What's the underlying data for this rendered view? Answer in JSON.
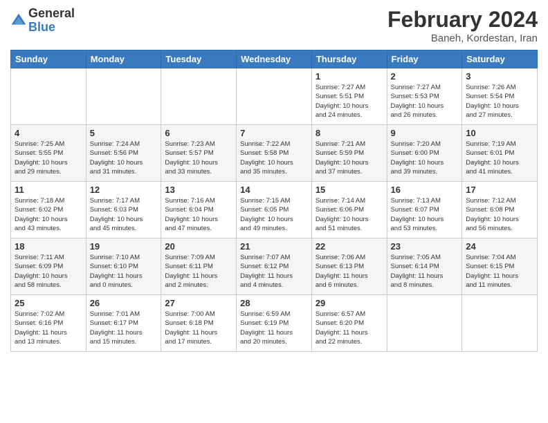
{
  "header": {
    "logo_line1": "General",
    "logo_line2": "Blue",
    "month_year": "February 2024",
    "location": "Baneh, Kordestan, Iran"
  },
  "weekdays": [
    "Sunday",
    "Monday",
    "Tuesday",
    "Wednesday",
    "Thursday",
    "Friday",
    "Saturday"
  ],
  "weeks": [
    [
      {
        "day": "",
        "info": ""
      },
      {
        "day": "",
        "info": ""
      },
      {
        "day": "",
        "info": ""
      },
      {
        "day": "",
        "info": ""
      },
      {
        "day": "1",
        "info": "Sunrise: 7:27 AM\nSunset: 5:51 PM\nDaylight: 10 hours\nand 24 minutes."
      },
      {
        "day": "2",
        "info": "Sunrise: 7:27 AM\nSunset: 5:53 PM\nDaylight: 10 hours\nand 26 minutes."
      },
      {
        "day": "3",
        "info": "Sunrise: 7:26 AM\nSunset: 5:54 PM\nDaylight: 10 hours\nand 27 minutes."
      }
    ],
    [
      {
        "day": "4",
        "info": "Sunrise: 7:25 AM\nSunset: 5:55 PM\nDaylight: 10 hours\nand 29 minutes."
      },
      {
        "day": "5",
        "info": "Sunrise: 7:24 AM\nSunset: 5:56 PM\nDaylight: 10 hours\nand 31 minutes."
      },
      {
        "day": "6",
        "info": "Sunrise: 7:23 AM\nSunset: 5:57 PM\nDaylight: 10 hours\nand 33 minutes."
      },
      {
        "day": "7",
        "info": "Sunrise: 7:22 AM\nSunset: 5:58 PM\nDaylight: 10 hours\nand 35 minutes."
      },
      {
        "day": "8",
        "info": "Sunrise: 7:21 AM\nSunset: 5:59 PM\nDaylight: 10 hours\nand 37 minutes."
      },
      {
        "day": "9",
        "info": "Sunrise: 7:20 AM\nSunset: 6:00 PM\nDaylight: 10 hours\nand 39 minutes."
      },
      {
        "day": "10",
        "info": "Sunrise: 7:19 AM\nSunset: 6:01 PM\nDaylight: 10 hours\nand 41 minutes."
      }
    ],
    [
      {
        "day": "11",
        "info": "Sunrise: 7:18 AM\nSunset: 6:02 PM\nDaylight: 10 hours\nand 43 minutes."
      },
      {
        "day": "12",
        "info": "Sunrise: 7:17 AM\nSunset: 6:03 PM\nDaylight: 10 hours\nand 45 minutes."
      },
      {
        "day": "13",
        "info": "Sunrise: 7:16 AM\nSunset: 6:04 PM\nDaylight: 10 hours\nand 47 minutes."
      },
      {
        "day": "14",
        "info": "Sunrise: 7:15 AM\nSunset: 6:05 PM\nDaylight: 10 hours\nand 49 minutes."
      },
      {
        "day": "15",
        "info": "Sunrise: 7:14 AM\nSunset: 6:06 PM\nDaylight: 10 hours\nand 51 minutes."
      },
      {
        "day": "16",
        "info": "Sunrise: 7:13 AM\nSunset: 6:07 PM\nDaylight: 10 hours\nand 53 minutes."
      },
      {
        "day": "17",
        "info": "Sunrise: 7:12 AM\nSunset: 6:08 PM\nDaylight: 10 hours\nand 56 minutes."
      }
    ],
    [
      {
        "day": "18",
        "info": "Sunrise: 7:11 AM\nSunset: 6:09 PM\nDaylight: 10 hours\nand 58 minutes."
      },
      {
        "day": "19",
        "info": "Sunrise: 7:10 AM\nSunset: 6:10 PM\nDaylight: 11 hours\nand 0 minutes."
      },
      {
        "day": "20",
        "info": "Sunrise: 7:09 AM\nSunset: 6:11 PM\nDaylight: 11 hours\nand 2 minutes."
      },
      {
        "day": "21",
        "info": "Sunrise: 7:07 AM\nSunset: 6:12 PM\nDaylight: 11 hours\nand 4 minutes."
      },
      {
        "day": "22",
        "info": "Sunrise: 7:06 AM\nSunset: 6:13 PM\nDaylight: 11 hours\nand 6 minutes."
      },
      {
        "day": "23",
        "info": "Sunrise: 7:05 AM\nSunset: 6:14 PM\nDaylight: 11 hours\nand 8 minutes."
      },
      {
        "day": "24",
        "info": "Sunrise: 7:04 AM\nSunset: 6:15 PM\nDaylight: 11 hours\nand 11 minutes."
      }
    ],
    [
      {
        "day": "25",
        "info": "Sunrise: 7:02 AM\nSunset: 6:16 PM\nDaylight: 11 hours\nand 13 minutes."
      },
      {
        "day": "26",
        "info": "Sunrise: 7:01 AM\nSunset: 6:17 PM\nDaylight: 11 hours\nand 15 minutes."
      },
      {
        "day": "27",
        "info": "Sunrise: 7:00 AM\nSunset: 6:18 PM\nDaylight: 11 hours\nand 17 minutes."
      },
      {
        "day": "28",
        "info": "Sunrise: 6:59 AM\nSunset: 6:19 PM\nDaylight: 11 hours\nand 20 minutes."
      },
      {
        "day": "29",
        "info": "Sunrise: 6:57 AM\nSunset: 6:20 PM\nDaylight: 11 hours\nand 22 minutes."
      },
      {
        "day": "",
        "info": ""
      },
      {
        "day": "",
        "info": ""
      }
    ]
  ]
}
